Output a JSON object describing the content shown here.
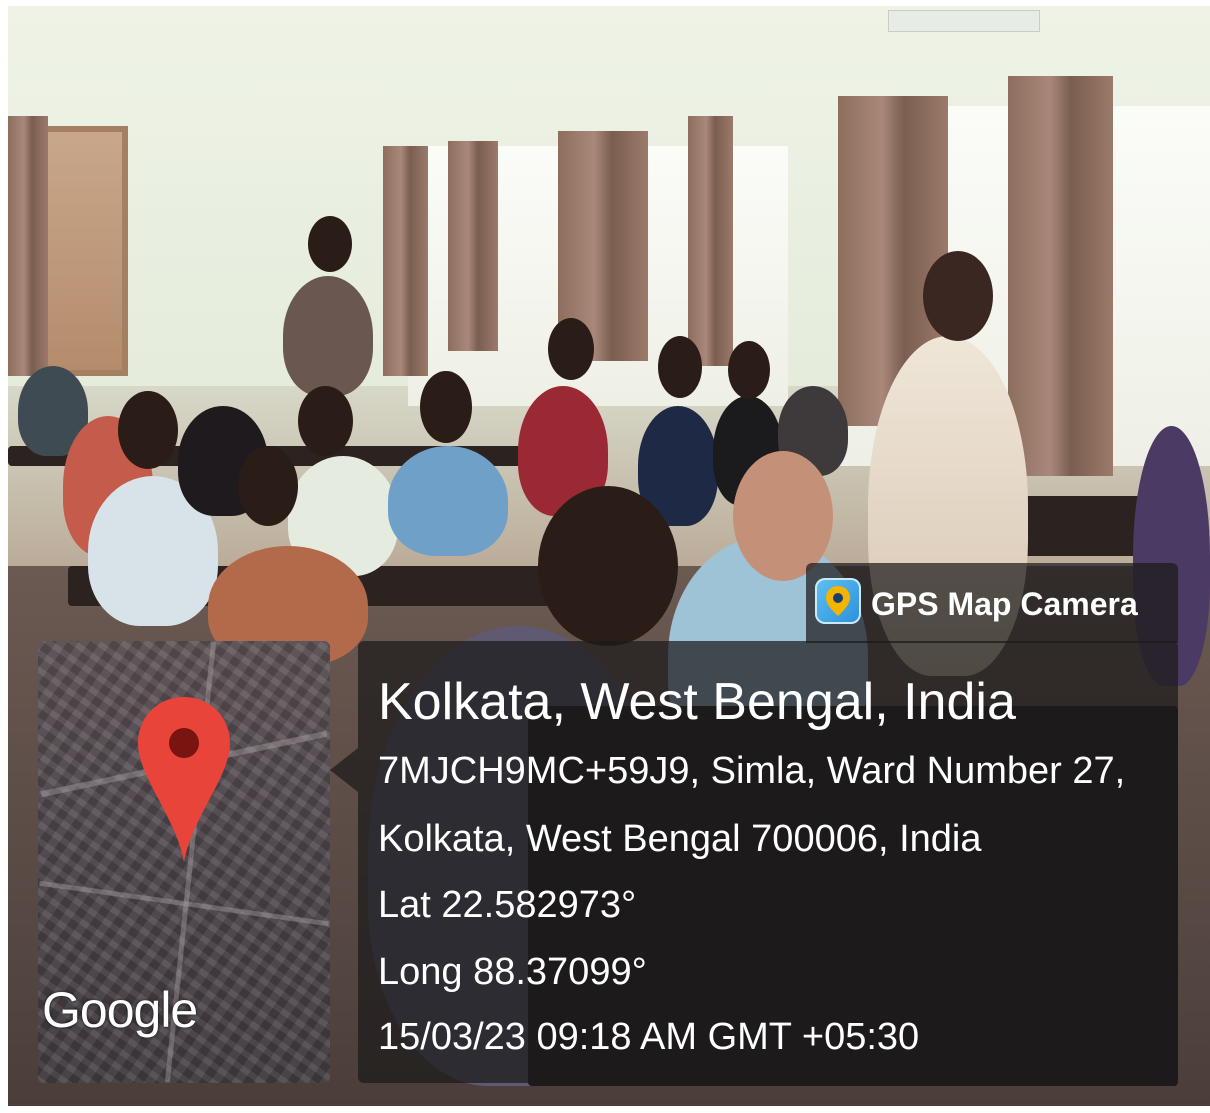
{
  "overlay": {
    "app_name": "GPS Map Camera",
    "map_brand": "Google",
    "location_title": "Kolkata, West Bengal, India",
    "address_line1": "7MJCH9MC+59J9, Simla, Ward Number 27,",
    "address_line2": "Kolkata, West Bengal 700006, India",
    "latitude": "Lat 22.582973°",
    "longitude": "Long 88.37099°",
    "datetime": "15/03/23 09:18 AM GMT +05:30"
  },
  "colors": {
    "pin": "#e8443a",
    "pin_dot": "#7a1410",
    "card_bg": "#1c1a1b",
    "text": "#ffffff"
  },
  "icons": [
    "map-pin-icon",
    "gps-map-camera-app-icon"
  ]
}
